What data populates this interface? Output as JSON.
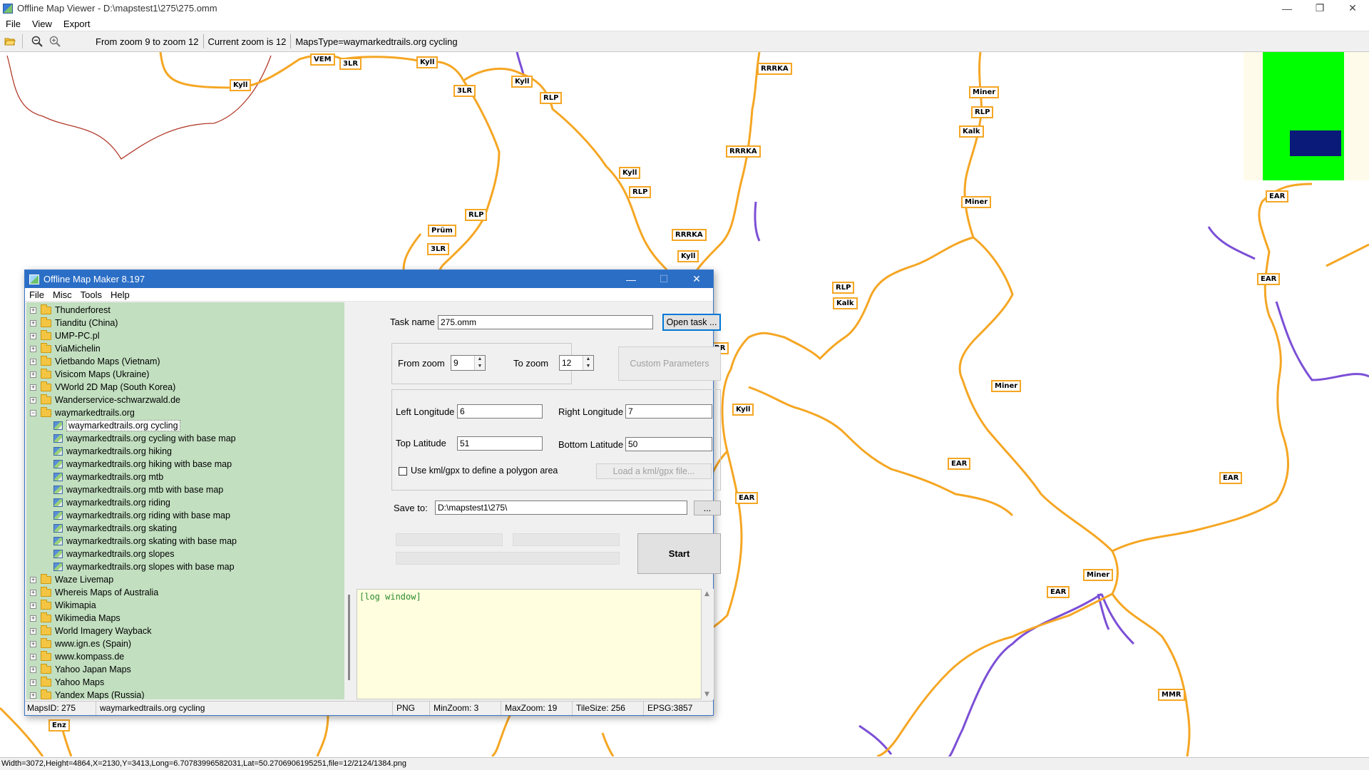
{
  "viewer": {
    "title": "Offline Map Viewer - D:\\mapstest1\\275\\275.omm",
    "window_controls": {
      "minimize": "—",
      "restore": "❐",
      "close": "✕"
    },
    "menu": [
      "File",
      "View",
      "Export"
    ],
    "toolbar": {
      "zoom_range": "From zoom 9 to zoom 12",
      "current_zoom": "Current zoom is 12",
      "maps_type": "MapsType=waymarkedtrails.org cycling"
    },
    "status": "Width=3072,Height=4864,X=2130,Y=3413,Long=6.70783996582031,Lat=50.2706906195251,file=12/2124/1384.png",
    "trail_labels": [
      "VEM",
      "3LR",
      "Kyll",
      "Kyll",
      "3LR",
      "Kyll",
      "RLP",
      "RRRKA",
      "Miner",
      "RLP",
      "Kalk",
      "RRRKA",
      "Kyll",
      "RLP",
      "Miner",
      "EAR",
      "RLP",
      "Prüm",
      "3LR",
      "RRRKA",
      "Kyll",
      "RLP",
      "Kalk",
      "EAR",
      "RR",
      "Miner",
      "Kyll",
      "EAR",
      "EAR",
      "EAR",
      "Miner",
      "EAR",
      "MMR",
      "Enz"
    ],
    "colors": {
      "trail": "#f5a623",
      "border": "#c0392b",
      "river": "#7b4fd6"
    }
  },
  "dialog": {
    "title": "Offline Map Maker 8.197",
    "window_controls": {
      "minimize": "—",
      "maximize": "☐",
      "close": "✕"
    },
    "menu": [
      "File",
      "Misc",
      "Tools",
      "Help"
    ],
    "tree": [
      {
        "label": "Thunderforest",
        "type": "folder",
        "expanded": false
      },
      {
        "label": "Tianditu (China)",
        "type": "folder",
        "expanded": false
      },
      {
        "label": "UMP-PC.pl",
        "type": "folder",
        "expanded": false
      },
      {
        "label": "ViaMichelin",
        "type": "folder",
        "expanded": false
      },
      {
        "label": "Vietbando Maps (Vietnam)",
        "type": "folder",
        "expanded": false
      },
      {
        "label": "Visicom Maps (Ukraine)",
        "type": "folder",
        "expanded": false
      },
      {
        "label": "VWorld 2D Map (South Korea)",
        "type": "folder",
        "expanded": false
      },
      {
        "label": "Wanderservice-schwarzwald.de",
        "type": "folder",
        "expanded": false
      },
      {
        "label": "waymarkedtrails.org",
        "type": "folder",
        "expanded": true
      },
      {
        "label": "waymarkedtrails.org cycling",
        "type": "map",
        "selected": true
      },
      {
        "label": "waymarkedtrails.org cycling with base map",
        "type": "map"
      },
      {
        "label": "waymarkedtrails.org hiking",
        "type": "map"
      },
      {
        "label": "waymarkedtrails.org hiking with base map",
        "type": "map"
      },
      {
        "label": "waymarkedtrails.org mtb",
        "type": "map"
      },
      {
        "label": "waymarkedtrails.org mtb with base map",
        "type": "map"
      },
      {
        "label": "waymarkedtrails.org riding",
        "type": "map"
      },
      {
        "label": "waymarkedtrails.org riding with base map",
        "type": "map"
      },
      {
        "label": "waymarkedtrails.org skating",
        "type": "map"
      },
      {
        "label": "waymarkedtrails.org skating with base map",
        "type": "map"
      },
      {
        "label": "waymarkedtrails.org slopes",
        "type": "map"
      },
      {
        "label": "waymarkedtrails.org slopes with base map",
        "type": "map"
      },
      {
        "label": "Waze Livemap",
        "type": "folder",
        "expanded": false
      },
      {
        "label": "Whereis Maps of Australia",
        "type": "folder",
        "expanded": false
      },
      {
        "label": "Wikimapia",
        "type": "folder",
        "expanded": false
      },
      {
        "label": "Wikimedia Maps",
        "type": "folder",
        "expanded": false
      },
      {
        "label": "World Imagery Wayback",
        "type": "folder",
        "expanded": false
      },
      {
        "label": "www.ign.es (Spain)",
        "type": "folder",
        "expanded": false
      },
      {
        "label": "www.kompass.de",
        "type": "folder",
        "expanded": false
      },
      {
        "label": "Yahoo Japan Maps",
        "type": "folder",
        "expanded": false
      },
      {
        "label": "Yahoo Maps",
        "type": "folder",
        "expanded": false
      },
      {
        "label": "Yandex Maps (Russia)",
        "type": "folder",
        "expanded": false
      }
    ],
    "form": {
      "task_name_label": "Task name",
      "task_name_value": "275.omm",
      "open_task_button": "Open task ...",
      "from_zoom_label": "From zoom",
      "from_zoom_value": "9",
      "to_zoom_label": "To zoom",
      "to_zoom_value": "12",
      "custom_parameters_button": "Custom Parameters",
      "left_longitude_label": "Left Longitude",
      "left_longitude_value": "6",
      "right_longitude_label": "Right Longitude",
      "right_longitude_value": "7",
      "top_latitude_label": "Top Latitude",
      "top_latitude_value": "51",
      "bottom_latitude_label": "Bottom Latitude",
      "bottom_latitude_value": "50",
      "use_kml_label": "Use kml/gpx to define a polygon area",
      "load_kml_button": "Load a kml/gpx file...",
      "save_to_label": "Save to:",
      "save_to_value": "D:\\mapstest1\\275\\",
      "browse_button": "...",
      "start_button": "Start",
      "log_text": "[log window]"
    },
    "status": {
      "maps_id": "MapsID: 275",
      "maps_name": "waymarkedtrails.org cycling",
      "format": "PNG",
      "min_zoom": "MinZoom: 3",
      "max_zoom": "MaxZoom: 19",
      "tile_size": "TileSize: 256",
      "epsg": "EPSG:3857"
    }
  }
}
